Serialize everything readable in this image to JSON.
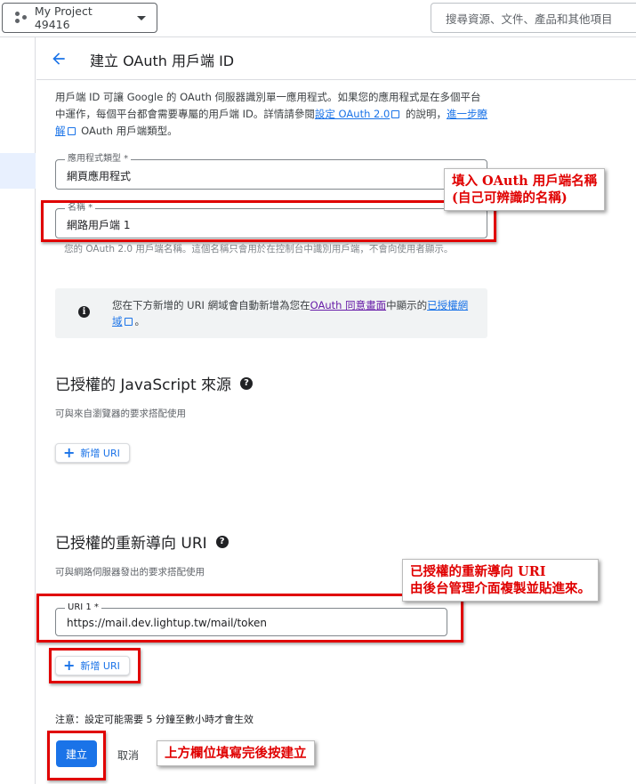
{
  "topbar": {
    "project_name": "My Project 49416",
    "search_placeholder": "搜尋資源、文件、產品和其他項目"
  },
  "header": {
    "title": "建立 OAuth 用戶端 ID"
  },
  "intro": {
    "part1": "用戶端 ID 可讓 Google 的 OAuth 伺服器識別單一應用程式。如果您的應用程式是在多個平台中運作，每個平台都會需要專屬的用戶端 ID。詳情請參閱",
    "link1": "設定 OAuth 2.0",
    "part2": " 的說明，",
    "link2": "進一步瞭解",
    "part3": " OAuth 用戶端類型。"
  },
  "fields": {
    "app_type_label": "應用程式類型 *",
    "app_type_value": "網頁應用程式",
    "name_label": "名稱 *",
    "name_value": "網路用戶端 1",
    "name_helper": "您的 OAuth 2.0 用戶端名稱。這個名稱只會用於在控制台中識別用戶端，不會向使用者顯示。"
  },
  "info": {
    "part1": "您在下方新增的 URI 網域會自動新增為您在",
    "link1": "OAuth 同意畫面",
    "part2": "中顯示的",
    "link2": "已授權網域",
    "part3": "。"
  },
  "js_origins": {
    "title": "已授權的 JavaScript 來源",
    "subtitle": "可與來自瀏覽器的要求搭配使用",
    "add_label": "新增 URI"
  },
  "redirect": {
    "title": "已授權的重新導向 URI",
    "subtitle": "可與網路伺服器發出的要求搭配使用",
    "uri_label": "URI 1 *",
    "uri_value": "https://mail.dev.lightup.tw/mail/token",
    "add_label": "新增 URI"
  },
  "footer": {
    "note": "注意：設定可能需要 5 分鐘至數小時才會生效",
    "create_label": "建立",
    "cancel_label": "取消"
  },
  "annotations": {
    "name_line1": "填入 OAuth 用戶端名稱",
    "name_line2": "(自己可辨識的名稱)",
    "redirect_line1": "已授權的重新導向 URI",
    "redirect_line2": "由後台管理介面複製並貼進來。",
    "create_line1": "上方欄位填寫完後按建立"
  },
  "colors": {
    "accent": "#1a73e8",
    "annotation_red": "#e00000"
  }
}
